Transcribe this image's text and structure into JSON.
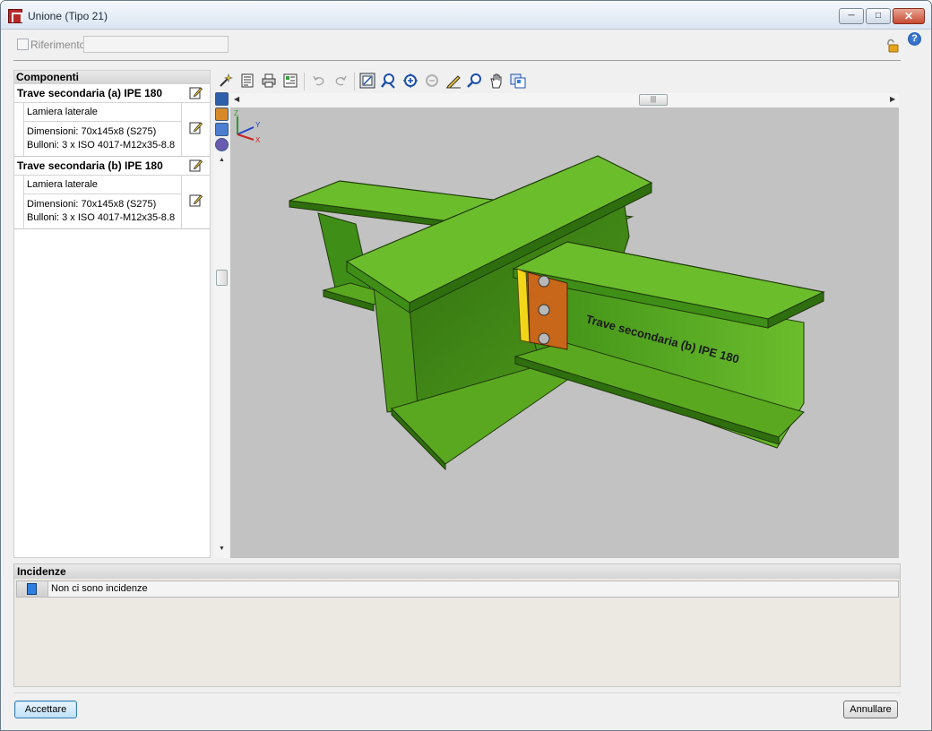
{
  "window": {
    "title": "Unione (Tipo 21)"
  },
  "reference": {
    "label": "Riferimento",
    "value": ""
  },
  "components": {
    "header": "Componenti",
    "items": [
      {
        "title": "Trave secondaria (a) IPE 180",
        "sub_title": "Lamiera laterale",
        "dimensions": "Dimensioni: 70x145x8 (S275)",
        "bolts": "Bulloni: 3 x ISO 4017-M12x35-8.8"
      },
      {
        "title": "Trave secondaria (b) IPE 180",
        "sub_title": "Lamiera laterale",
        "dimensions": "Dimensioni: 70x145x8 (S275)",
        "bolts": "Bulloni: 3 x ISO 4017-M12x35-8.8"
      }
    ]
  },
  "viewport": {
    "beam_label": "Trave secondaria (b) IPE 180",
    "axis_labels": {
      "x": "X",
      "y": "Y",
      "z": "Z"
    },
    "colors": {
      "steel": "#5aa820",
      "plate": "#c8661a",
      "weld": "#f2d61a",
      "background": "#c2c2c2"
    }
  },
  "incidences": {
    "header": "Incidenze",
    "message": "Non ci sono incidenze"
  },
  "buttons": {
    "accept": "Accettare",
    "cancel": "Annullare"
  },
  "toolbar_icons": [
    "wand-icon",
    "list-icon",
    "print-icon",
    "report-icon",
    "undo-icon",
    "redo-icon",
    "zoom-window-icon",
    "zoom-extents-icon",
    "zoom-in-icon",
    "zoom-out-icon",
    "pencil-icon",
    "zoom-search-icon",
    "pan-hand-icon",
    "copy-view-icon"
  ]
}
